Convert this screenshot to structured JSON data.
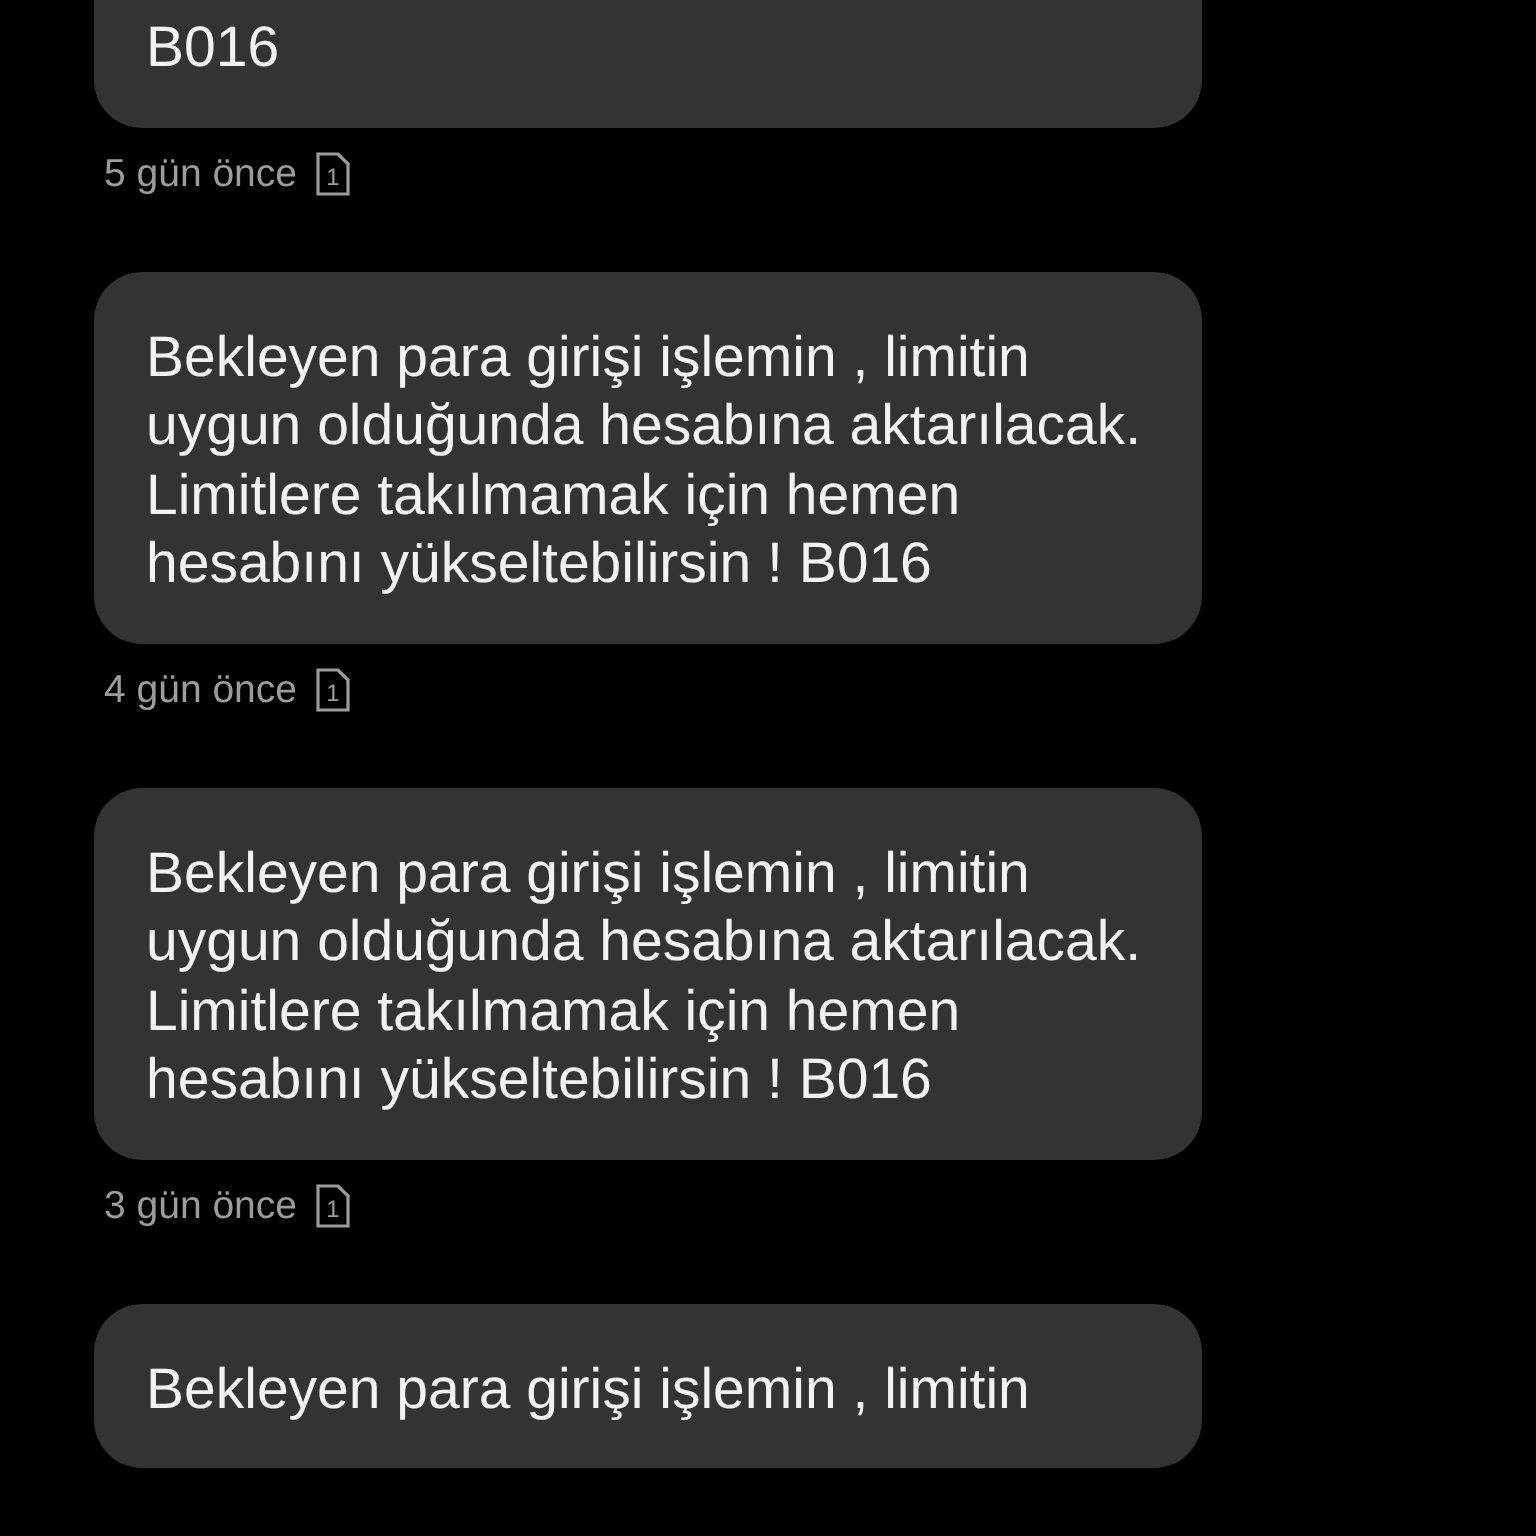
{
  "messages": [
    {
      "text": "B016",
      "time": "5 gün önce",
      "sim": "1"
    },
    {
      "text": "Bekleyen para girişi işlemin , limitin uygun olduğunda hesabına aktarılacak. Limitlere takılmamak için hemen hesabını yükseltebilirsin ! B016",
      "time": "4 gün önce",
      "sim": "1"
    },
    {
      "text": "Bekleyen para girişi işlemin , limitin uygun olduğunda hesabına aktarılacak. Limitlere takılmamak için hemen hesabını yükseltebilirsin ! B016",
      "time": "3 gün önce",
      "sim": "1"
    },
    {
      "text": "Bekleyen para girişi işlemin , limitin"
    }
  ]
}
